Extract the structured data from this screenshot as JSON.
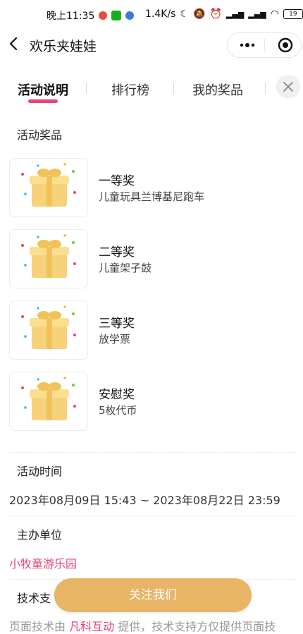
{
  "status_bar": {
    "time": "晚上11:35",
    "net_speed": "1.4K/s",
    "battery": "19"
  },
  "nav": {
    "title": "欢乐夹娃娃"
  },
  "tabs": [
    {
      "label": "活动说明",
      "active": true
    },
    {
      "label": "排行榜",
      "active": false
    },
    {
      "label": "我的奖品",
      "active": false
    }
  ],
  "prizes_section": {
    "title": "活动奖品",
    "items": [
      {
        "name": "一等奖",
        "desc": "儿童玩具兰博基尼跑车"
      },
      {
        "name": "二等奖",
        "desc": "儿童架子鼓"
      },
      {
        "name": "三等奖",
        "desc": "放学票"
      },
      {
        "name": "安慰奖",
        "desc": "5枚代币"
      }
    ]
  },
  "time_section": {
    "title": "活动时间",
    "value": "2023年08月09日 15:43 ~ 2023年08月22日 23:59"
  },
  "organizer_section": {
    "title": "主办单位",
    "value": "小牧童游乐园"
  },
  "tech_section": {
    "title": "技术支",
    "footer_prefix": "页面技术由",
    "footer_link": "凡科互动",
    "footer_suffix": "提供，技术支持方仅提供页面技"
  },
  "follow_button": "关注我们",
  "colors": {
    "accent": "#e84371",
    "button": "#e8b465",
    "highlight": "#fde6ea"
  }
}
